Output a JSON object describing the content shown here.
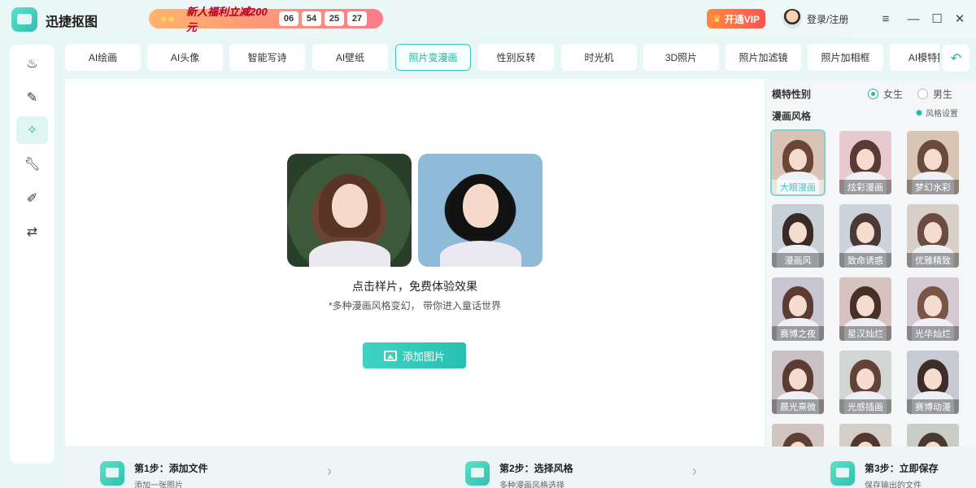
{
  "app": {
    "title": "迅捷抠图"
  },
  "promo": {
    "text": "新人福利立减200元",
    "countdown": [
      "06",
      "54",
      "25",
      "27"
    ]
  },
  "header": {
    "vip_label": "开通VIP",
    "login_label": "登录/注册"
  },
  "window_controls": [
    "menu-icon",
    "minimize-icon",
    "maximize-icon",
    "close-icon"
  ],
  "left_nav": [
    {
      "icon": "fire-icon",
      "active": false
    },
    {
      "icon": "edit-board-icon",
      "active": false
    },
    {
      "icon": "sparkle-icon",
      "active": true
    },
    {
      "icon": "wrench-icon",
      "active": false
    },
    {
      "icon": "pencil-icon",
      "active": false
    },
    {
      "icon": "convert-icon",
      "active": false
    }
  ],
  "tabs": [
    {
      "label": "AI绘画"
    },
    {
      "label": "AI头像"
    },
    {
      "label": "智能写诗"
    },
    {
      "label": "AI壁纸"
    },
    {
      "label": "照片变漫画",
      "active": true
    },
    {
      "label": "性别反转"
    },
    {
      "label": "时光机"
    },
    {
      "label": "3D照片"
    },
    {
      "label": "照片加滤镜"
    },
    {
      "label": "照片加相框"
    },
    {
      "label": "AI模特换"
    }
  ],
  "canvas": {
    "hint_title": "点击样片，免费体验效果",
    "hint_sub": "*多种漫画风格变幻， 带你进入童话世界",
    "add_button": "添加图片"
  },
  "right_panel": {
    "gender_label": "模特性别",
    "gender_options": [
      {
        "label": "女生",
        "selected": true
      },
      {
        "label": "男生",
        "selected": false
      }
    ],
    "style_label": "漫画风格",
    "style_settings": "风格设置",
    "styles": [
      {
        "label": "大眼漫画",
        "selected": true
      },
      {
        "label": "炫彩漫画"
      },
      {
        "label": "梦幻水彩"
      },
      {
        "label": "漫画风"
      },
      {
        "label": "致命诱惑"
      },
      {
        "label": "优雅精致"
      },
      {
        "label": "赛博之夜"
      },
      {
        "label": "星汉灿烂"
      },
      {
        "label": "光华灿烂"
      },
      {
        "label": "晨光熹微"
      },
      {
        "label": "光感插画"
      },
      {
        "label": "赛博动漫"
      },
      {
        "label": ""
      },
      {
        "label": ""
      },
      {
        "label": ""
      }
    ]
  },
  "steps": [
    {
      "title": "第1步：添加文件",
      "sub": "添加一张图片"
    },
    {
      "title": "第2步：选择风格",
      "sub": "多种漫画风格选择"
    },
    {
      "title": "第3步：立即保存",
      "sub": "保存输出的文件"
    }
  ]
}
